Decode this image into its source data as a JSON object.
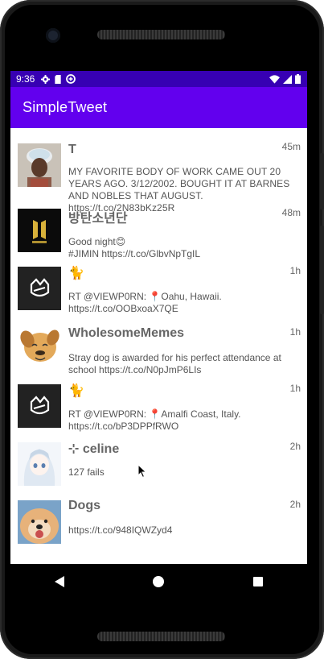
{
  "status_bar": {
    "time": "9:36",
    "icons_left": [
      "gear-icon",
      "sd-card-icon",
      "data-saver-icon"
    ],
    "icons_right": [
      "wifi-icon",
      "signal-icon",
      "battery-icon"
    ]
  },
  "app_bar": {
    "title": "SimpleTweet"
  },
  "tweets": [
    {
      "name": "T",
      "time": "45m",
      "text": "MY FAVORITE BODY OF WORK CAME OUT 20 YEARS AGO. 3/12/2002. BOUGHT IT AT BARNES AND NOBLES THAT AUGUST. https://t.co/2N83bKz25R",
      "avatar": "portrait-photo"
    },
    {
      "name": "방탄소년단",
      "time": "48m",
      "text": "Good night😊\n#JIMIN https://t.co/GlbvNpTgIL",
      "avatar": "bts-logo"
    },
    {
      "name": "🐈",
      "time": "1h",
      "text": "RT @VIEWP0RN: 📍Oahu, Hawaii. https://t.co/OOBxoaX7QE",
      "avatar": "cat-logo"
    },
    {
      "name": "WholesomeMemes",
      "time": "1h",
      "text": "Stray dog is awarded for his perfect attendance at school https://t.co/N0pJmP6LIs",
      "avatar": "cartoon-dog"
    },
    {
      "name": "🐈",
      "time": "1h",
      "text": "RT @VIEWP0RN: 📍Amalfi Coast, Italy. https://t.co/bP3DPPfRWO",
      "avatar": "cat-logo"
    },
    {
      "name": "⊹ celine",
      "time": "2h",
      "text": "127 fails",
      "avatar": "anime-girl"
    },
    {
      "name": "Dogs",
      "time": "2h",
      "text": "https://t.co/948IQWZyd4",
      "avatar": "dog-photo"
    }
  ],
  "nav_bar": {
    "icons": [
      "back-icon",
      "home-icon",
      "recents-icon"
    ]
  }
}
